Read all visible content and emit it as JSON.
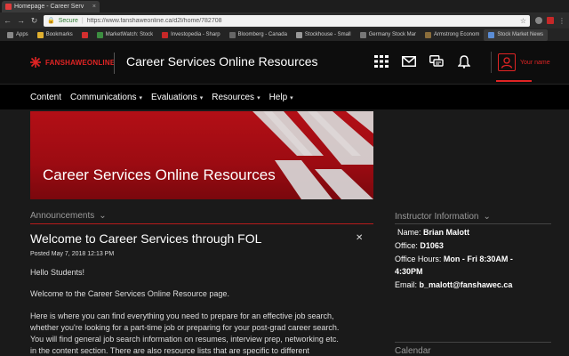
{
  "browser": {
    "tab_title": "Homepage - Career Serv",
    "tab_close": "×",
    "secure_label": "Secure",
    "url": "https://www.fanshaweonline.ca/d2l/home/782708",
    "bookmarks": [
      {
        "label": "Apps",
        "color": "#888888"
      },
      {
        "label": "Bookmarks",
        "color": "#e0b030"
      },
      {
        "label": "",
        "color": "#d32f2f"
      },
      {
        "label": "MarketWatch: Stock",
        "color": "#3c8d40"
      },
      {
        "label": "Investopedia - Sharp",
        "color": "#c62828"
      },
      {
        "label": "Bloomberg - Canada",
        "color": "#666666"
      },
      {
        "label": "Stockhouse - Small",
        "color": "#999999"
      },
      {
        "label": "Germany Stock Mar",
        "color": "#777777"
      },
      {
        "label": "Armstrong Econom",
        "color": "#8a6d3b"
      },
      {
        "label": "Stock Market News",
        "color": "#5b8dd6"
      }
    ]
  },
  "header": {
    "logo_text": "FANSHAWEONLINE",
    "title": "Career Services Online Resources",
    "profile_name": "Your name"
  },
  "nav": {
    "items": [
      {
        "label": "Content",
        "dropdown": false
      },
      {
        "label": "Communications",
        "dropdown": true
      },
      {
        "label": "Evaluations",
        "dropdown": true
      },
      {
        "label": "Resources",
        "dropdown": true
      },
      {
        "label": "Help",
        "dropdown": true
      }
    ]
  },
  "banner": {
    "title": "Career Services Online Resources"
  },
  "announcements": {
    "heading": "Announcements",
    "title": "Welcome to Career Services through FOL",
    "posted": "Posted May 7, 2018 12:13 PM",
    "greeting": "Hello Students!",
    "intro": "Welcome to the Career Services Online Resource page.",
    "body_lines": [
      "Here is where you can find everything you need to prepare for an effective job search,",
      "whether you're looking for a part-time job or preparing for your post-grad career search.",
      "You will find general job search information on resumes, interview prep, networking etc.",
      "in the content section. There are also resource lists that are specific to different"
    ]
  },
  "instructor": {
    "heading": "Instructor Information",
    "name_label": "Name:",
    "name_value": "Brian Malott",
    "office_label": "Office:",
    "office_value": "D1063",
    "hours_label": "Office Hours:",
    "hours_value": "Mon - Fri 8:30AM -",
    "hours_value_2": "4:30PM",
    "email_label": "Email:",
    "email_value": "b_malott@fanshawec.ca"
  },
  "calendar": {
    "heading": "Calendar"
  },
  "colors": {
    "brand_red": "#e02424",
    "banner_red": "#b30f16",
    "background": "#1a1a1a"
  }
}
